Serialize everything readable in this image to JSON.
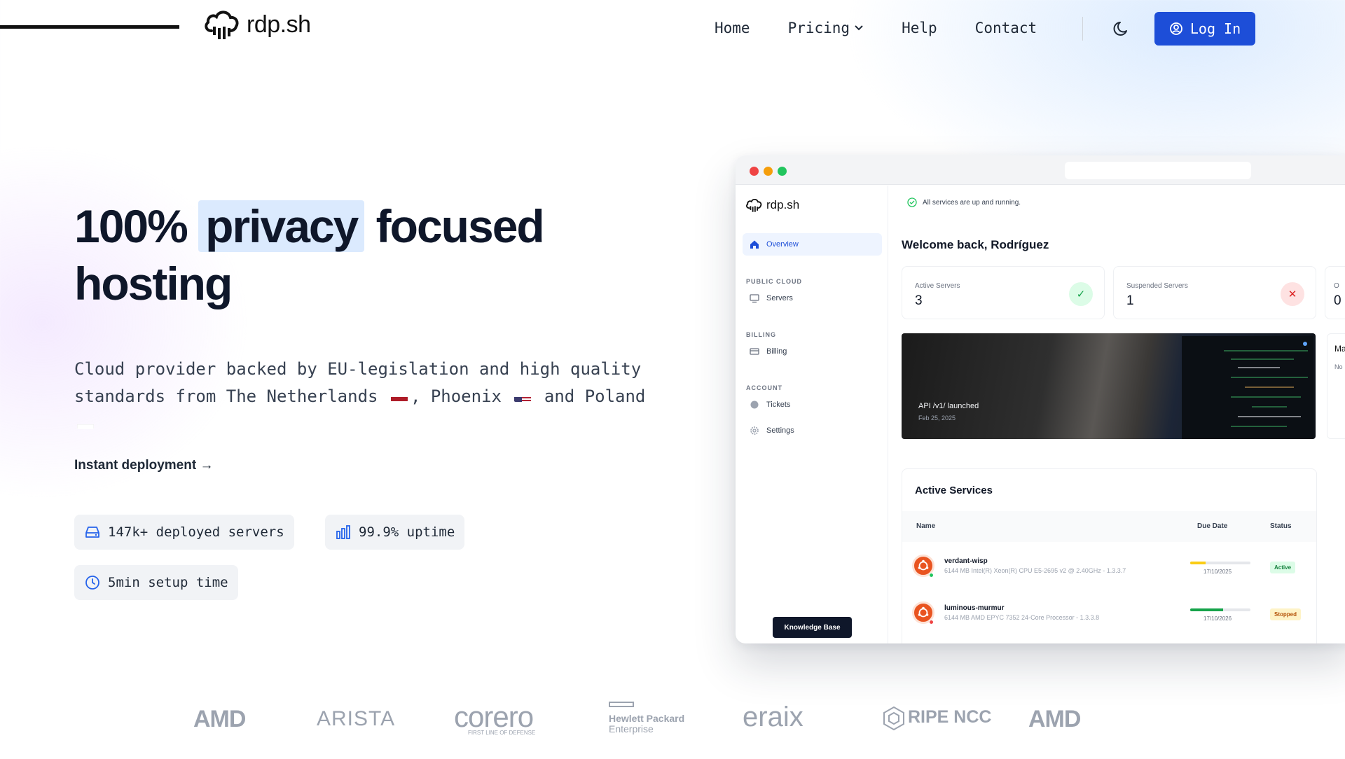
{
  "nav": {
    "brand": "rdp.sh",
    "links": [
      "Home",
      "Pricing",
      "Help",
      "Contact"
    ],
    "login_label": "Log In"
  },
  "hero": {
    "title_part1": "100%",
    "title_highlight": "privacy",
    "title_part2": "focused",
    "title_line2": "hosting",
    "sub_part1": "Cloud provider backed by EU-legislation and high quality standards from The Netherlands",
    "sub_part2": ", Phoenix",
    "sub_part3": "and Poland",
    "cta": "Instant deployment →",
    "stats": [
      "147k+ deployed servers",
      "99.9% uptime",
      "5min setup time"
    ]
  },
  "dashboard": {
    "brand": "rdp.sh",
    "sidebar": {
      "overview": "Overview",
      "group_public_cloud": "PUBLIC CLOUD",
      "servers": "Servers",
      "group_billing": "BILLING",
      "billing": "Billing",
      "group_account": "ACCOUNT",
      "tickets": "Tickets",
      "settings": "Settings",
      "knowledge_base": "Knowledge Base"
    },
    "status": "All services are up and running.",
    "welcome": "Welcome back, Rodríguez",
    "cards": [
      {
        "label": "Active Servers",
        "value": "3"
      },
      {
        "label": "Suspended Servers",
        "value": "1"
      },
      {
        "label": "O",
        "value": "0"
      }
    ],
    "news": {
      "title": "API /v1/ launched",
      "date": "Feb 25, 2025"
    },
    "news2_title": "Ma",
    "news2_text": "No",
    "services": {
      "title": "Active Services",
      "columns": [
        "Name",
        "Due Date",
        "Status"
      ],
      "rows": [
        {
          "name": "verdant-wisp",
          "spec": "6144 MB Intel(R) Xeon(R) CPU E5-2695 v2 @ 2.40GHz - 1.3.3.7",
          "due": "17/10/2025",
          "status": "Active",
          "progress": 0.25,
          "bar_color": "#facc15"
        },
        {
          "name": "luminous-murmur",
          "spec": "6144 MB AMD EPYC 7352 24-Core Processor - 1.3.3.8",
          "due": "17/10/2026",
          "status": "Stopped",
          "progress": 0.55,
          "bar_color": "#16a34a"
        }
      ]
    }
  },
  "partner_logos": [
    "AMD",
    "ARISTA",
    "corero",
    "FIRST LINE OF DEFENSE",
    "Hewlett Packard",
    "Enterprise",
    "eraix",
    "RIPE NCC",
    "AMD"
  ],
  "colors": {
    "accent": "#1d4ed8",
    "highlight": "#dbeafe",
    "dark": "#0f172a"
  }
}
